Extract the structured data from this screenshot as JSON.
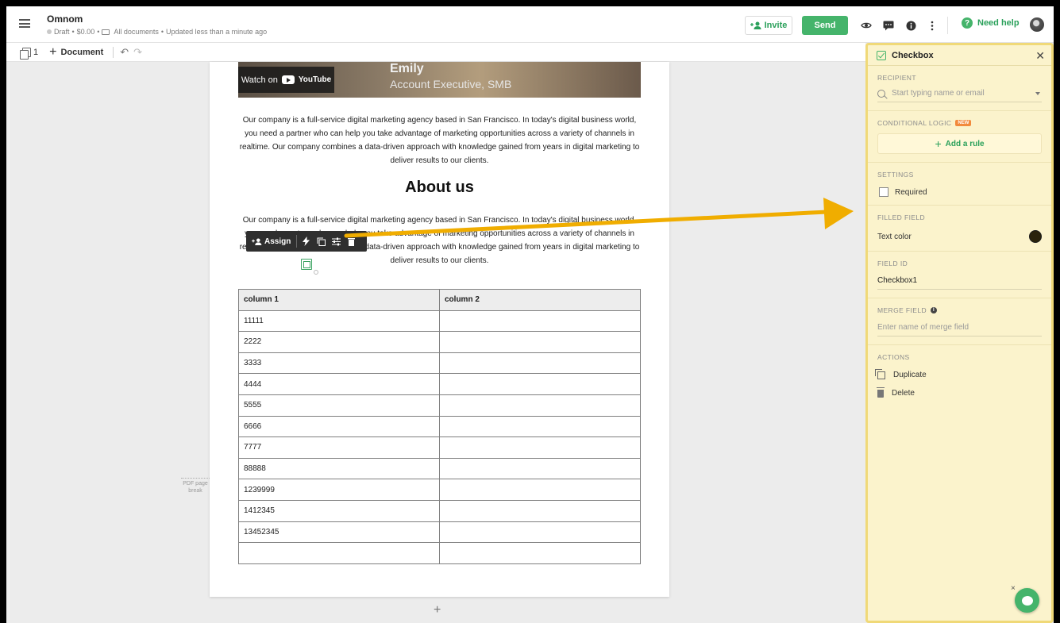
{
  "header": {
    "app_title": "Omnom",
    "status": "Draft",
    "price": "$0.00",
    "folder": "All documents",
    "updated": "Updated less than a minute ago",
    "invite_label": "Invite",
    "send_label": "Send",
    "help_label": "Need help",
    "icons": [
      "menu-icon",
      "eye-icon",
      "chat-icon",
      "info-icon",
      "more-icon",
      "help-icon"
    ]
  },
  "toolbar": {
    "page_count": "1",
    "add_document_label": "Document"
  },
  "document": {
    "video": {
      "name": "Emily",
      "role": "Account Executive, SMB",
      "watch_label": "Watch on",
      "platform": "YouTube"
    },
    "intro_paragraph": "Our company is a full-service digital marketing agency based in San Francisco. In today's digital business world, you need a partner who can help you take advantage of marketing opportunities across a variety of channels in realtime. Our company combines a data-driven approach with knowledge gained from years in digital marketing to deliver results to our clients.",
    "about_heading": "About us",
    "about_paragraph": "Our company is a full-service digital marketing agency based in San Francisco. In today's digital business world, you need a partner who can help you take advantage of marketing opportunities across a variety of channels in realtime. Our company combines a data-driven approach with knowledge gained from years in digital marketing to deliver results to our clients.",
    "field_toolbar": {
      "assign_label": "Assign"
    },
    "table": {
      "headers": [
        "column 1",
        "column 2"
      ],
      "rows": [
        [
          "11111",
          ""
        ],
        [
          "2222",
          ""
        ],
        [
          "3333",
          ""
        ],
        [
          "4444",
          ""
        ],
        [
          "5555",
          ""
        ],
        [
          "6666",
          ""
        ],
        [
          "7777",
          ""
        ],
        [
          "88888",
          ""
        ],
        [
          "1239999",
          ""
        ],
        [
          "1412345",
          ""
        ],
        [
          "13452345",
          ""
        ],
        [
          "",
          ""
        ]
      ]
    },
    "page_break_label": "PDF page break",
    "add_page_symbol": "+"
  },
  "panel": {
    "title": "Checkbox",
    "recipient_label": "RECIPIENT",
    "recipient_placeholder": "Start typing name or email",
    "conditional_logic_label": "CONDITIONAL LOGIC",
    "new_badge": "NEW",
    "add_rule_label": "Add a rule",
    "settings_label": "SETTINGS",
    "required_label": "Required",
    "required_checked": false,
    "filled_field_label": "FILLED FIELD",
    "text_color_label": "Text color",
    "text_color_value": "#2a230c",
    "field_id_label": "FIELD ID",
    "field_id_value": "Checkbox1",
    "merge_field_label": "MERGE FIELD",
    "merge_field_placeholder": "Enter name of merge field",
    "actions_label": "ACTIONS",
    "duplicate_label": "Duplicate",
    "delete_label": "Delete"
  },
  "colors": {
    "accent_green": "#45b46b",
    "panel_bg": "#fbf3cc",
    "panel_border": "#f0d978",
    "annotation_arrow": "#f0ad00"
  }
}
